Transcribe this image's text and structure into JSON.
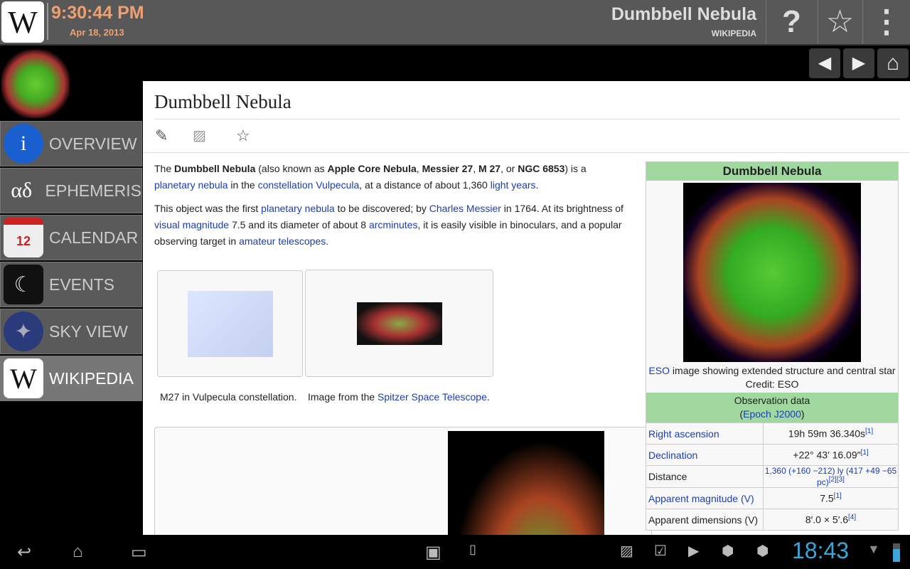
{
  "topbar": {
    "logo": "W",
    "time": "9:30:44 PM",
    "date": "Apr 18, 2013",
    "title": "Dumbbell Nebula",
    "subtitle": "WIKIPEDIA",
    "help": "?",
    "star": "☆",
    "menu": "⋮"
  },
  "nav": {
    "back": "◀",
    "forward": "▶",
    "home": "⌂"
  },
  "sidebar": {
    "items": [
      {
        "label": "OVERVIEW",
        "icon": "i"
      },
      {
        "label": "EPHEMERIS",
        "icon": "αδ"
      },
      {
        "label": "CALENDAR",
        "icon": "12"
      },
      {
        "label": "EVENTS",
        "icon": "☾"
      },
      {
        "label": "SKY VIEW",
        "icon": "✦"
      },
      {
        "label": "WIKIPEDIA",
        "icon": "W"
      }
    ]
  },
  "article": {
    "title": "Dumbbell Nebula",
    "p1": {
      "t1": "The ",
      "b1": "Dumbbell Nebula",
      "t2": " (also known as ",
      "b2": "Apple Core Nebula",
      "t3": ", ",
      "b3": "Messier 27",
      "t4": ", ",
      "b4": "M 27",
      "t5": ", or ",
      "b5": "NGC 6853",
      "t6": ") is a ",
      "l1": "planetary nebula",
      "t7": " in the ",
      "l2": "constellation",
      "t8": " ",
      "l3": "Vulpecula",
      "t9": ", at a distance of about 1,360 ",
      "l4": "light years",
      "t10": "."
    },
    "p2": {
      "t1": "This object was the first ",
      "l1": "planetary nebula",
      "t2": " to be discovered; by ",
      "l2": "Charles Messier",
      "t3": " in 1764. At its brightness of ",
      "l3": "visual magnitude",
      "t4": " 7.5 and its diameter of about 8 ",
      "l4": "arcminutes",
      "t5": ", it is easily visible in binoculars, and a popular observing target in ",
      "l5": "amateur telescopes",
      "t6": "."
    },
    "cap1": "M27 in Vulpecula constellation.",
    "cap2_t": "Image from the ",
    "cap2_l": "Spitzer Space Telescope",
    "cap2_e": "."
  },
  "infobox": {
    "title": "Dumbbell Nebula",
    "cap_link": "ESO",
    "cap_text": " image showing extended structure and central star",
    "credit": "Credit: ESO",
    "section": "Observation data",
    "epoch_l": "Epoch J2000",
    "rows": [
      {
        "k": "Right ascension",
        "v": "19h 59m 36.340s",
        "ref": "[1]"
      },
      {
        "k": "Declination",
        "v": "+22° 43′ 16.09″",
        "ref": "[1]"
      },
      {
        "k": "Distance",
        "v": "1,360 (+160 −212) ly (417 +49 −65 pc)",
        "ref": "[2][3]"
      },
      {
        "k": "Apparent magnitude (V)",
        "v": "7.5",
        "ref": "[1]"
      },
      {
        "k": "Apparent dimensions (V)",
        "v": "8′.0 × 5′.6",
        "ref": "[4]"
      }
    ]
  },
  "statusbar": {
    "clock": "18:43"
  },
  "colors": {
    "accent_time": "#f0a070",
    "infobox_header": "#a0d8a0",
    "link": "#1a3fb0",
    "clock": "#3aa7d8"
  }
}
